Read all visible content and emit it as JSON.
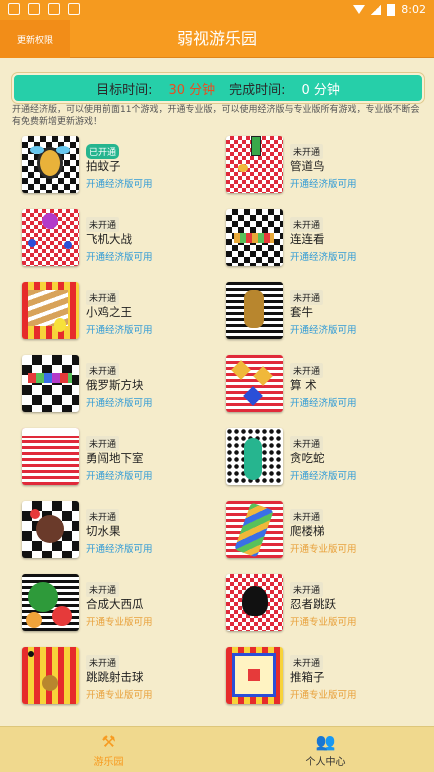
{
  "status": {
    "time": "8:02"
  },
  "header": {
    "update_label": "更新权限",
    "title": "弱视游乐园"
  },
  "timebar": {
    "target_label": "目标时间:",
    "target_value": "30 分钟",
    "done_label": "完成时间:",
    "done_value": "0 分钟"
  },
  "notice": "开通经济版，可以使用前面11个游戏，开通专业版，可以使用经济版与专业版所有游戏，专业版不断会有免费新增更新游戏！",
  "games": [
    {
      "status": "已开通",
      "name": "拍蚊子",
      "availability": "开通经济版可用"
    },
    {
      "status": "未开通",
      "name": "管道鸟",
      "availability": "开通经济版可用"
    },
    {
      "status": "未开通",
      "name": "飞机大战",
      "availability": "开通经济版可用"
    },
    {
      "status": "未开通",
      "name": "连连看",
      "availability": "开通经济版可用"
    },
    {
      "status": "未开通",
      "name": "小鸡之王",
      "availability": "开通经济版可用"
    },
    {
      "status": "未开通",
      "name": "套牛",
      "availability": "开通经济版可用"
    },
    {
      "status": "未开通",
      "name": "俄罗斯方块",
      "availability": "开通经济版可用"
    },
    {
      "status": "未开通",
      "name": "算 术",
      "availability": "开通经济版可用"
    },
    {
      "status": "未开通",
      "name": "勇闯地下室",
      "availability": "开通经济版可用"
    },
    {
      "status": "未开通",
      "name": "贪吃蛇",
      "availability": "开通经济版可用"
    },
    {
      "status": "未开通",
      "name": "切水果",
      "availability": "开通经济版可用"
    },
    {
      "status": "未开通",
      "name": "爬楼梯",
      "availability": "开通专业版可用"
    },
    {
      "status": "未开通",
      "name": "合成大西瓜",
      "availability": "开通专业版可用"
    },
    {
      "status": "未开通",
      "name": "忍者跳跃",
      "availability": "开通专业版可用"
    },
    {
      "status": "未开通",
      "name": "跳跳射击球",
      "availability": "开通专业版可用"
    },
    {
      "status": "未开通",
      "name": "推箱子",
      "availability": "开通专业版可用"
    }
  ],
  "tabs": [
    {
      "label": "游乐园",
      "icon": "park-icon"
    },
    {
      "label": "个人中心",
      "icon": "user-icon"
    }
  ],
  "colors": {
    "accent": "#f79b20",
    "teal": "#26cfa9",
    "economy": "#2f9ad6",
    "pro": "#e8a03a"
  }
}
